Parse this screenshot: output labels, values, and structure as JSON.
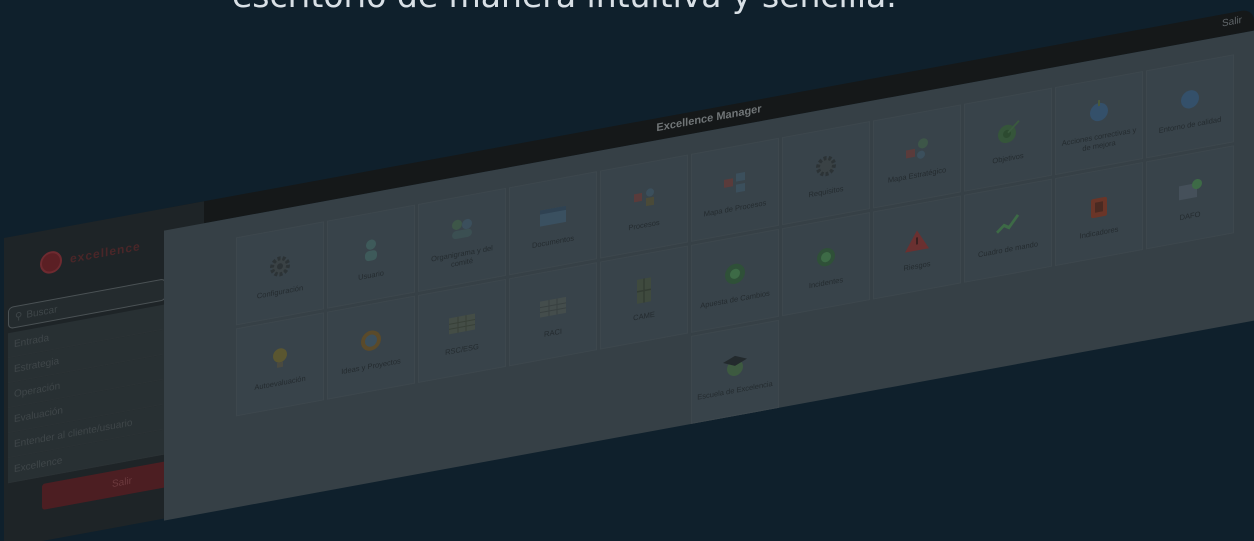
{
  "headline": "escritorio de manera intuitiva y sencilla.",
  "window": {
    "title": "Excellence Manager",
    "control": "Salir"
  },
  "sidebar": {
    "logo_text": "excellence",
    "search_placeholder": "Buscar",
    "items": [
      {
        "label": "Entrada"
      },
      {
        "label": "Estrategia"
      },
      {
        "label": "Operación"
      },
      {
        "label": "Evaluación"
      },
      {
        "label": "Entender al cliente/usuario"
      },
      {
        "label": "Excellence"
      }
    ],
    "exit_label": "Salir"
  },
  "tiles": [
    {
      "label": "Configuración",
      "icon": "gear-icon"
    },
    {
      "label": "Usuario",
      "icon": "user-icon"
    },
    {
      "label": "Organigrama y del comité",
      "icon": "people-icon"
    },
    {
      "label": "Documentos",
      "icon": "document-icon"
    },
    {
      "label": "Procesos",
      "icon": "process-icon"
    },
    {
      "label": "Mapa de Procesos",
      "icon": "process-map-icon"
    },
    {
      "label": "Requisitos",
      "icon": "settings-icon"
    },
    {
      "label": "Mapa Estratégico",
      "icon": "strategy-map-icon"
    },
    {
      "label": "Objetivos",
      "icon": "target-icon"
    },
    {
      "label": "Acciones correctivas y de mejora",
      "icon": "globe-icon"
    },
    {
      "label": "Incidentes",
      "icon": "incident-icon"
    },
    {
      "label": "Riesgos",
      "icon": "risk-icon"
    },
    {
      "label": "Cuadro de mando",
      "icon": "warning-icon"
    },
    {
      "label": "Indicadores",
      "icon": "chart-icon"
    },
    {
      "label": "DAFO",
      "icon": "swot-icon"
    },
    {
      "label": "Autoevaluación",
      "icon": "self-evaluation-icon"
    },
    {
      "label": "Ideas y Proyectos",
      "icon": "lightbulb-icon"
    },
    {
      "label": "RSC/ESG",
      "icon": "world-icon"
    },
    {
      "label": "RACI",
      "icon": "table-icon"
    },
    {
      "label": "CAME",
      "icon": "table-icon"
    },
    {
      "label": "Apuesta de Cambios",
      "icon": "door-icon"
    },
    {
      "label": "Entorno de calidad",
      "icon": "quality-icon"
    },
    {
      "label": "Escuela de Excelencia",
      "icon": "graduation-cap-icon"
    }
  ]
}
